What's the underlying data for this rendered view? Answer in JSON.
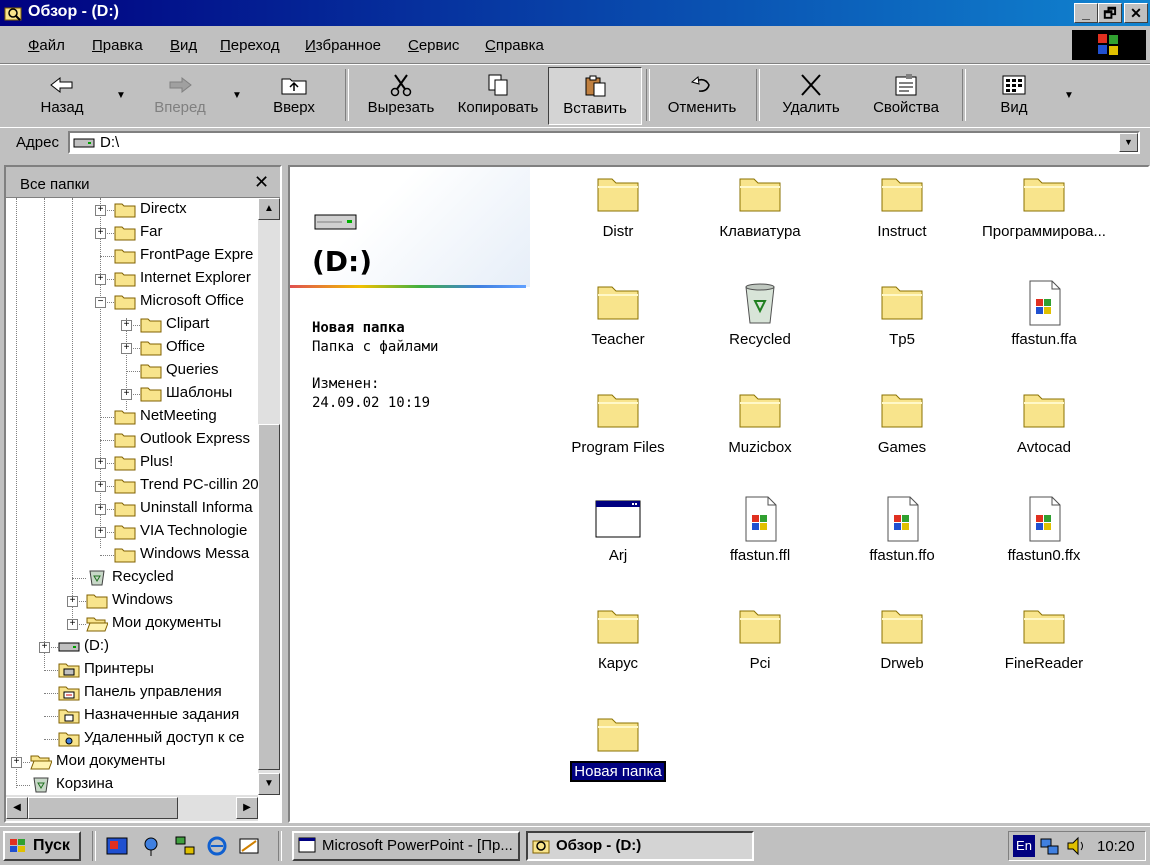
{
  "window": {
    "title": "Обзор -  (D:)",
    "min": "_",
    "max": "🗗",
    "close": "✕"
  },
  "menu": [
    "Файл",
    "Правка",
    "Вид",
    "Переход",
    "Избранное",
    "Сервис",
    "Справка"
  ],
  "toolbar": {
    "back": "Назад",
    "forward": "Вперед",
    "up": "Вверх",
    "cut": "Вырезать",
    "copy": "Копировать",
    "paste": "Вставить",
    "undo": "Отменить",
    "delete": "Удалить",
    "properties": "Свойства",
    "view": "Вид"
  },
  "address": {
    "label": "Адрес",
    "value": "D:\\"
  },
  "tree": {
    "title": "Все папки",
    "close": "✕",
    "items": [
      {
        "label": "Directx",
        "icon": "folder",
        "pm": "+"
      },
      {
        "label": "Far",
        "icon": "folder",
        "pm": "+"
      },
      {
        "label": "FrontPage Expre",
        "icon": "folder",
        "pm": ""
      },
      {
        "label": "Internet Explorer",
        "icon": "folder",
        "pm": "+"
      },
      {
        "label": "Microsoft Office",
        "icon": "folder",
        "pm": "−"
      },
      {
        "label": "Clipart",
        "icon": "folder",
        "pm": "+"
      },
      {
        "label": "Office",
        "icon": "folder",
        "pm": "+"
      },
      {
        "label": "Queries",
        "icon": "folder",
        "pm": ""
      },
      {
        "label": "Шаблоны",
        "icon": "folder",
        "pm": "+"
      },
      {
        "label": "NetMeeting",
        "icon": "folder",
        "pm": ""
      },
      {
        "label": "Outlook Express",
        "icon": "folder",
        "pm": ""
      },
      {
        "label": "Plus!",
        "icon": "folder",
        "pm": "+"
      },
      {
        "label": "Trend PC-cillin 20",
        "icon": "folder",
        "pm": "+"
      },
      {
        "label": "Uninstall Informa",
        "icon": "folder",
        "pm": "+"
      },
      {
        "label": "VIA Technologie",
        "icon": "folder",
        "pm": "+"
      },
      {
        "label": "Windows Messa",
        "icon": "folder",
        "pm": ""
      },
      {
        "label": "Recycled",
        "icon": "recycle",
        "pm": ""
      },
      {
        "label": "Windows",
        "icon": "folder",
        "pm": "+"
      },
      {
        "label": "Мои документы",
        "icon": "folder-open",
        "pm": "+"
      },
      {
        "label": "(D:)",
        "icon": "drive",
        "pm": "+"
      },
      {
        "label": "Принтеры",
        "icon": "printer",
        "pm": ""
      },
      {
        "label": "Панель управления",
        "icon": "control",
        "pm": ""
      },
      {
        "label": "Назначенные задания",
        "icon": "tasks",
        "pm": ""
      },
      {
        "label": "Удаленный доступ к се",
        "icon": "dialup",
        "pm": ""
      },
      {
        "label": "Мои документы",
        "icon": "folder-open",
        "pm": "+"
      },
      {
        "label": "Корзина",
        "icon": "recycle",
        "pm": ""
      }
    ]
  },
  "info": {
    "drive": "(D:)",
    "name": "Новая папка",
    "type": "Папка с файлами",
    "modified_label": "Изменен:",
    "modified": "24.09.02 10:19"
  },
  "files": [
    {
      "name": "Distr",
      "icon": "folder"
    },
    {
      "name": "Клавиатура",
      "icon": "folder"
    },
    {
      "name": "Instruct",
      "icon": "folder"
    },
    {
      "name": "Программирова...",
      "icon": "folder"
    },
    {
      "name": "Teacher",
      "icon": "folder"
    },
    {
      "name": "Recycled",
      "icon": "recycle"
    },
    {
      "name": "Tp5",
      "icon": "folder"
    },
    {
      "name": "ffastun.ffa",
      "icon": "file"
    },
    {
      "name": "Program Files",
      "icon": "folder"
    },
    {
      "name": "Muzicbox",
      "icon": "folder"
    },
    {
      "name": "Games",
      "icon": "folder"
    },
    {
      "name": "Avtocad",
      "icon": "folder"
    },
    {
      "name": "Arj",
      "icon": "app"
    },
    {
      "name": "ffastun.ffl",
      "icon": "file"
    },
    {
      "name": "ffastun.ffo",
      "icon": "file"
    },
    {
      "name": "ffastun0.ffx",
      "icon": "file"
    },
    {
      "name": "Карус",
      "icon": "folder"
    },
    {
      "name": "Pci",
      "icon": "folder"
    },
    {
      "name": "Drweb",
      "icon": "folder"
    },
    {
      "name": "FineReader",
      "icon": "folder"
    },
    {
      "name": "Новая папка",
      "icon": "folder",
      "selected": true
    }
  ],
  "taskbar": {
    "start": "Пуск",
    "apps": [
      {
        "label": "Microsoft PowerPoint - [Пр...",
        "active": false
      },
      {
        "label": "Обзор -  (D:)",
        "active": true
      }
    ],
    "lang": "En",
    "clock": "10:20"
  },
  "colors": {
    "title_start": "#000080",
    "title_end": "#1084d0",
    "folder": "#f8e48c",
    "selection": "#000080"
  }
}
